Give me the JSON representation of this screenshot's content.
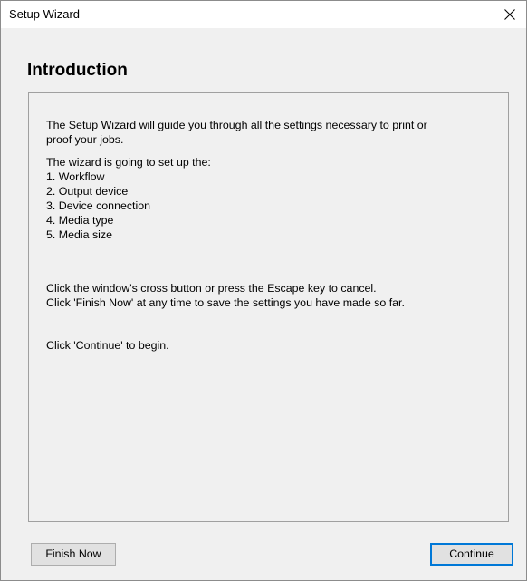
{
  "window": {
    "title": "Setup Wizard"
  },
  "page": {
    "heading": "Introduction"
  },
  "body": {
    "intro_line1": "The Setup Wizard will guide you through all the settings necessary to print or",
    "intro_line2": "proof your jobs.",
    "list_intro": "The wizard is going to set up the:",
    "items": [
      "1. Workflow",
      "2. Output device",
      "3. Device connection",
      "4. Media type",
      "5. Media size"
    ],
    "cancel_hint": "Click the window's cross button or press the Escape key to cancel.",
    "finish_hint": "Click 'Finish Now' at any time to save the settings you have made so far.",
    "begin_hint": "Click 'Continue' to begin."
  },
  "buttons": {
    "finish_now": "Finish Now",
    "continue": "Continue"
  },
  "icons": {
    "close": "close-icon"
  },
  "colors": {
    "window_bg": "#f0f0f0",
    "titlebar_bg": "#ffffff",
    "default_button_border": "#0078d7"
  }
}
